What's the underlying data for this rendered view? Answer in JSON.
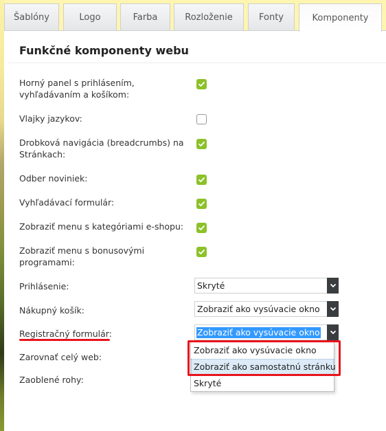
{
  "tabs": [
    {
      "label": "Šablóny",
      "active": false
    },
    {
      "label": "Logo",
      "active": false
    },
    {
      "label": "Farba",
      "active": false
    },
    {
      "label": "Rozloženie",
      "active": false
    },
    {
      "label": "Fonty",
      "active": false
    },
    {
      "label": "Komponenty",
      "active": true
    }
  ],
  "panel": {
    "title": "Funkčné komponenty webu"
  },
  "checkbox_rows": [
    {
      "label": "Horný panel s prihlásením, vyhľadávaním a košíkom:",
      "checked": true
    },
    {
      "label": "Vlajky jazykov:",
      "checked": false
    },
    {
      "label": "Drobková navigácia (breadcrumbs) na Stránkach:",
      "checked": true
    },
    {
      "label": "Odber noviniek:",
      "checked": true
    },
    {
      "label": "Vyhľadávací formulár:",
      "checked": true
    },
    {
      "label": "Zobraziť menu s kategóriami e-shopu:",
      "checked": true
    },
    {
      "label": "Zobraziť menu s bonusovými programami:",
      "checked": true
    }
  ],
  "select_rows": [
    {
      "label": "Prihlásenie:",
      "value": "Skryté"
    },
    {
      "label": "Nákupný košík:",
      "value": "Zobraziť ako vysúvacie okno"
    },
    {
      "label": "Registračný formulár:",
      "value": "Zobraziť ako vysúvacie okno",
      "open": true
    },
    {
      "label": "Zarovnať celý web:"
    },
    {
      "label": "Zaoblené rohy:"
    }
  ],
  "dropdown": {
    "options": [
      "Zobraziť ako vysúvacie okno",
      "Zobraziť ako samostatnú stránku",
      "Skryté"
    ],
    "hovered_index": 1
  },
  "colors": {
    "checkbox_on": "#8cc12a",
    "annotation_red": "#e8131c",
    "selection_blue": "#3399ff",
    "background_yellow": "#fdf5b0"
  }
}
